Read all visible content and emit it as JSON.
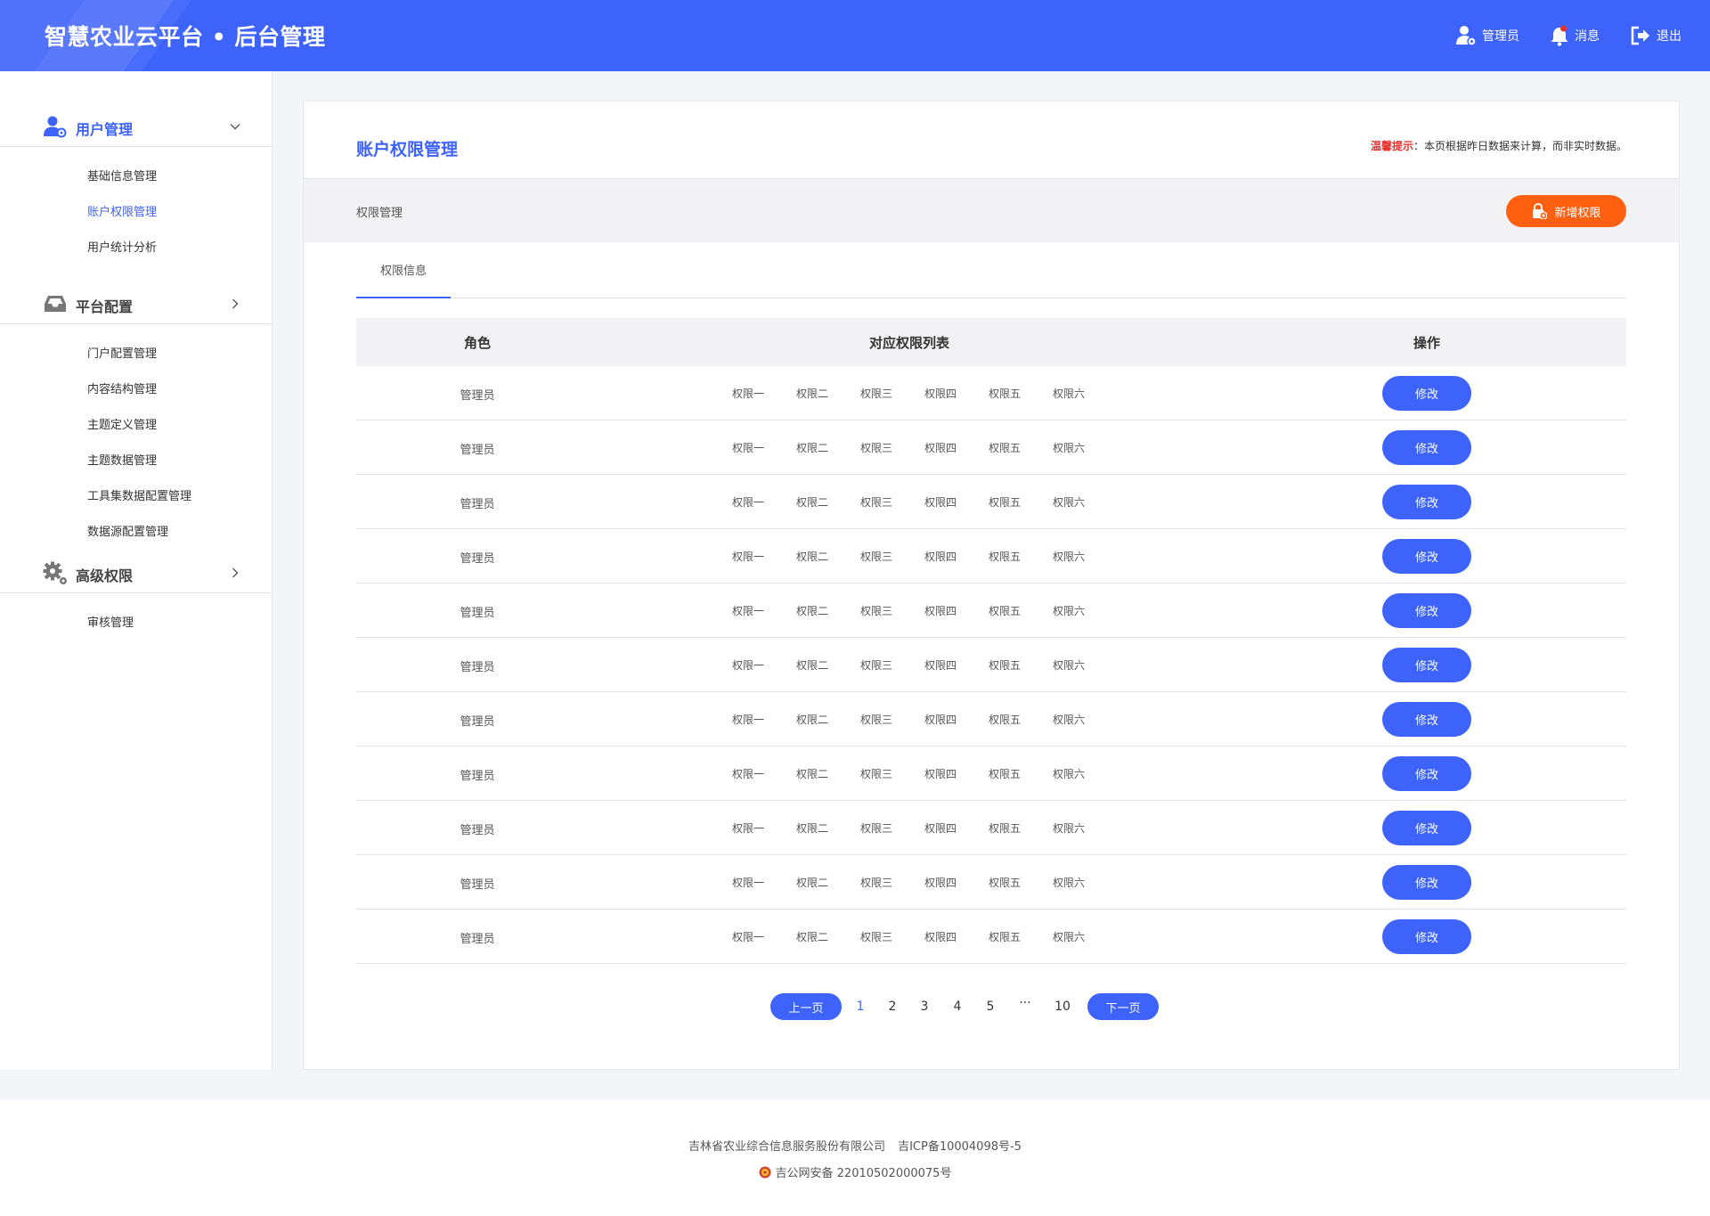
{
  "header": {
    "brand": "智慧农业云平台 • 后台管理",
    "admin_label": "管理员",
    "messages_label": "消息",
    "logout_label": "退出"
  },
  "sidebar": {
    "groups": [
      {
        "label": "用户管理",
        "icon": "user-gear-icon",
        "expanded": true,
        "items": [
          "基础信息管理",
          "账户权限管理",
          "用户统计分析"
        ]
      },
      {
        "label": "平台配置",
        "icon": "inbox-icon",
        "expanded": false,
        "items": [
          "门户配置管理",
          "内容结构管理",
          "主题定义管理",
          "主题数据管理",
          "工具集数据配置管理",
          "数据源配置管理"
        ]
      },
      {
        "label": "高级权限",
        "icon": "gears-icon",
        "expanded": false,
        "items": [
          "审核管理"
        ]
      }
    ],
    "active_item": "账户权限管理"
  },
  "main": {
    "title": "账户权限管理",
    "tip_label": "温馨提示",
    "tip_text": "：本页根据昨日数据来计算，而非实时数据。",
    "toolbar_label": "权限管理",
    "add_button": "新增权限",
    "tab": "权限信息",
    "table": {
      "columns": [
        "角色",
        "对应权限列表",
        "操作"
      ],
      "rows": [
        {
          "role": "管理员",
          "perms": [
            "权限一",
            "权限二",
            "权限三",
            "权限四",
            "权限五",
            "权限六"
          ],
          "action": "修改"
        },
        {
          "role": "管理员",
          "perms": [
            "权限一",
            "权限二",
            "权限三",
            "权限四",
            "权限五",
            "权限六"
          ],
          "action": "修改"
        },
        {
          "role": "管理员",
          "perms": [
            "权限一",
            "权限二",
            "权限三",
            "权限四",
            "权限五",
            "权限六"
          ],
          "action": "修改"
        },
        {
          "role": "管理员",
          "perms": [
            "权限一",
            "权限二",
            "权限三",
            "权限四",
            "权限五",
            "权限六"
          ],
          "action": "修改"
        },
        {
          "role": "管理员",
          "perms": [
            "权限一",
            "权限二",
            "权限三",
            "权限四",
            "权限五",
            "权限六"
          ],
          "action": "修改"
        },
        {
          "role": "管理员",
          "perms": [
            "权限一",
            "权限二",
            "权限三",
            "权限四",
            "权限五",
            "权限六"
          ],
          "action": "修改"
        },
        {
          "role": "管理员",
          "perms": [
            "权限一",
            "权限二",
            "权限三",
            "权限四",
            "权限五",
            "权限六"
          ],
          "action": "修改"
        },
        {
          "role": "管理员",
          "perms": [
            "权限一",
            "权限二",
            "权限三",
            "权限四",
            "权限五",
            "权限六"
          ],
          "action": "修改"
        },
        {
          "role": "管理员",
          "perms": [
            "权限一",
            "权限二",
            "权限三",
            "权限四",
            "权限五",
            "权限六"
          ],
          "action": "修改"
        },
        {
          "role": "管理员",
          "perms": [
            "权限一",
            "权限二",
            "权限三",
            "权限四",
            "权限五",
            "权限六"
          ],
          "action": "修改"
        },
        {
          "role": "管理员",
          "perms": [
            "权限一",
            "权限二",
            "权限三",
            "权限四",
            "权限五",
            "权限六"
          ],
          "action": "修改"
        }
      ]
    },
    "pagination": {
      "prev": "上一页",
      "next": "下一页",
      "pages": [
        "1",
        "2",
        "3",
        "4",
        "5",
        "···",
        "10"
      ],
      "current": "1"
    }
  },
  "footer": {
    "company": "吉林省农业综合信息服务股份有限公司",
    "icp": "吉ICP备10004098号-5",
    "police": "吉公网安备 22010502000075号"
  },
  "colors": {
    "primary": "#3d63fb",
    "accent": "#ff6010",
    "tip_red": "#e8302f"
  }
}
